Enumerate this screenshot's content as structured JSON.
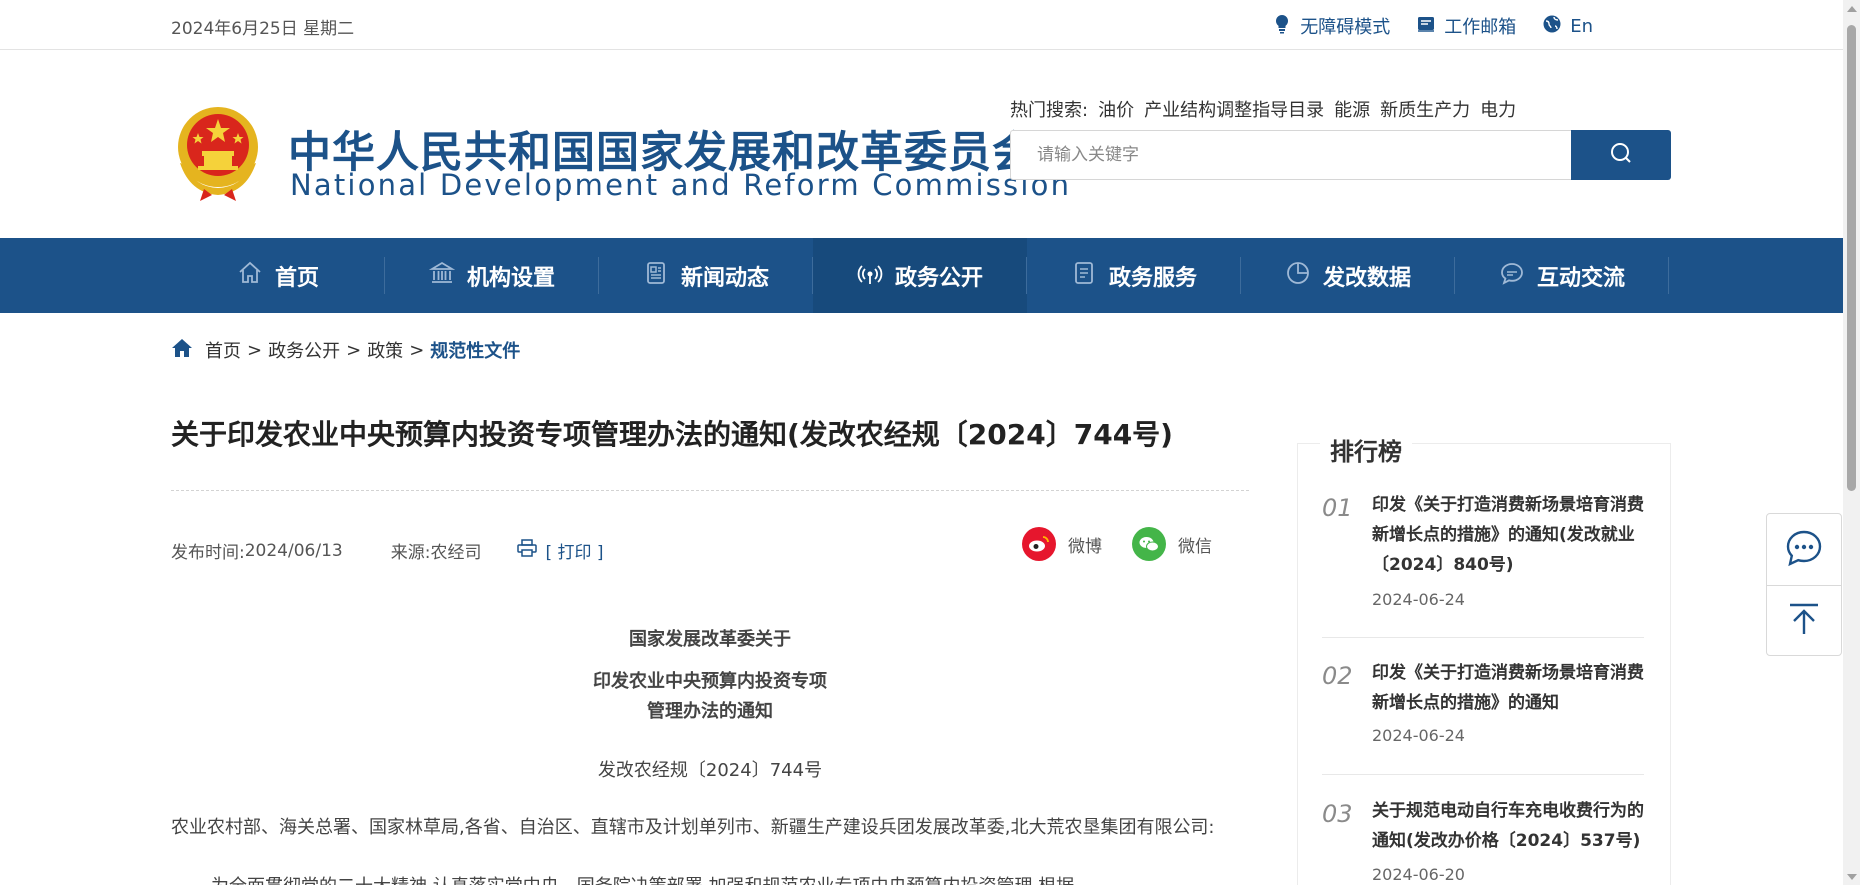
{
  "topbar": {
    "date": "2024年6月25日 星期二",
    "links": [
      {
        "label": "无障碍模式",
        "icon": "accessibility-icon"
      },
      {
        "label": "工作邮箱",
        "icon": "mailbox-icon"
      },
      {
        "label": "En",
        "icon": "globe-icon"
      }
    ]
  },
  "header": {
    "logo_cn": "中华人民共和国国家发展和改革委员会",
    "logo_en": "National Development and Reform Commission",
    "hot_label": "热门搜索:",
    "hot_keywords": [
      "油价",
      "产业结构调整指导目录",
      "能源",
      "新质生产力",
      "电力"
    ],
    "search_placeholder": "请输入关键字",
    "brand_color": "#1c5289"
  },
  "nav": {
    "items": [
      {
        "label": "首页",
        "icon": "home-icon"
      },
      {
        "label": "机构设置",
        "icon": "institution-icon"
      },
      {
        "label": "新闻动态",
        "icon": "news-icon"
      },
      {
        "label": "政务公开",
        "icon": "broadcast-icon",
        "active": true
      },
      {
        "label": "政务服务",
        "icon": "service-icon"
      },
      {
        "label": "发改数据",
        "icon": "pie-chart-icon"
      },
      {
        "label": "互动交流",
        "icon": "chat-bubble-icon"
      }
    ]
  },
  "breadcrumb": {
    "items": [
      "首页",
      "政务公开",
      "政策"
    ],
    "separator": ">",
    "current": "规范性文件"
  },
  "article": {
    "title": "关于印发农业中央预算内投资专项管理办法的通知(发改农经规〔2024〕744号)",
    "publish_label": "发布时间:",
    "publish_date": "2024/06/13",
    "source_label": "来源:",
    "source": "农经司",
    "print": "[ 打印 ]",
    "share": [
      {
        "label": "微博",
        "icon": "weibo-icon",
        "color": "#e6162d"
      },
      {
        "label": "微信",
        "icon": "wechat-icon",
        "color": "#44b549"
      }
    ],
    "heading_1": "国家发展改革委关于",
    "heading_2": "印发农业中央预算内投资专项",
    "heading_3": "管理办法的通知",
    "doc_number": "发改农经规〔2024〕744号",
    "recipients": "农业农村部、海关总署、国家林草局,各省、自治区、直辖市及计划单列市、新疆生产建设兵团发展改革委,北大荒农垦集团有限公司:",
    "body_first": "为全面贯彻党的二十大精神,认真落实党中央、国务院决策部署,加强和规范农业专项中央预算内投资管理,根据"
  },
  "ranking": {
    "title": "排行榜",
    "items": [
      {
        "num": "01",
        "title": "印发《关于打造消费新场景培育消费新增长点的措施》的通知(发改就业〔2024〕840号)",
        "date": "2024-06-24"
      },
      {
        "num": "02",
        "title": "印发《关于打造消费新场景培育消费新增长点的措施》的通知",
        "date": "2024-06-24"
      },
      {
        "num": "03",
        "title": "关于规范电动自行车充电收费行为的通知(发改办价格〔2024〕537号)",
        "date": "2024-06-20"
      }
    ]
  },
  "float_tools": [
    {
      "icon": "chat-icon"
    },
    {
      "icon": "back-to-top-icon"
    }
  ]
}
